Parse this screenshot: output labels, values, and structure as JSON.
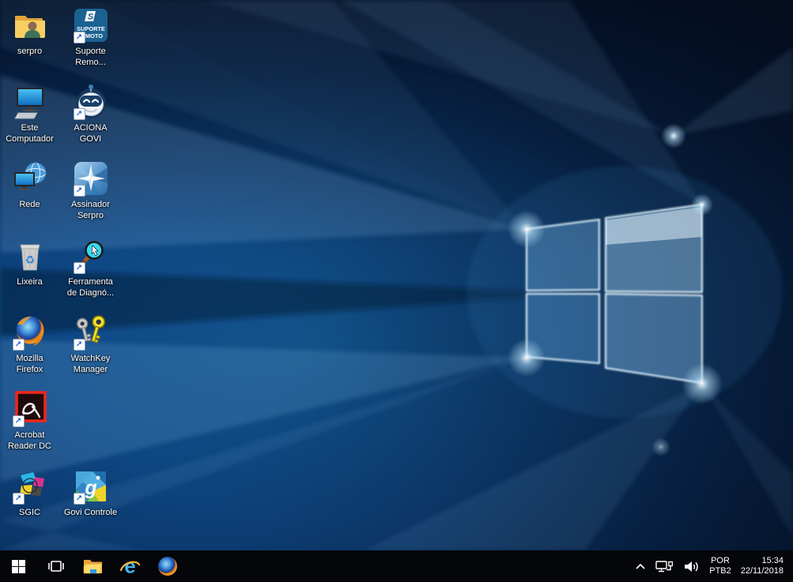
{
  "colors": {
    "taskbar_bg": "#040609",
    "wallpaper_dark": "#051733",
    "wallpaper_accent": "#2f8fd9",
    "icon_label_text": "#ffffff",
    "suporte_tile_blue": "#1b6191",
    "acrobat_red": "#f0261c",
    "shortcut_arrow_blue": "#1e5fd0"
  },
  "desktop": {
    "shortcut_arrow_glyph": "↗",
    "icons": [
      {
        "id": "serpro",
        "line1": "serpro"
      },
      {
        "id": "suporte-remoto",
        "line1": "Suporte",
        "line2": "Remo...",
        "tile_logo_letter": "S",
        "tile_text_line1": "SUPORTE",
        "tile_text_line2": "MOTO"
      },
      {
        "id": "este-computador",
        "line1": "Este",
        "line2": "Computador"
      },
      {
        "id": "aciona-govi",
        "line1": "ACIONA",
        "line2": "GOVI"
      },
      {
        "id": "rede",
        "line1": "Rede"
      },
      {
        "id": "assinador-serpro",
        "line1": "Assinador",
        "line2": "Serpro"
      },
      {
        "id": "lixeira",
        "line1": "Lixeira",
        "recycle_glyph": "♻"
      },
      {
        "id": "ferramenta-diagnostico",
        "line1": "Ferramenta",
        "line2": "de Diagnó..."
      },
      {
        "id": "mozilla-firefox",
        "line1": "Mozilla",
        "line2": "Firefox"
      },
      {
        "id": "watchkey-manager",
        "line1": "WatchKey",
        "line2": "Manager"
      },
      {
        "id": "acrobat-reader-dc",
        "line1": "Acrobat",
        "line2": "Reader DC"
      },
      {
        "id": "sgic",
        "line1": "SGIC"
      },
      {
        "id": "govi-controle",
        "line1": "Govi Controle",
        "tile_letter": "g"
      }
    ]
  },
  "taskbar": {
    "buttons": [
      "start",
      "task-view",
      "file-explorer",
      "internet-explorer",
      "firefox"
    ],
    "ie_letter": "e"
  },
  "tray": {
    "language_line1": "POR",
    "language_line2": "PTB2",
    "time": "15:34",
    "date": "22/11/2018"
  }
}
